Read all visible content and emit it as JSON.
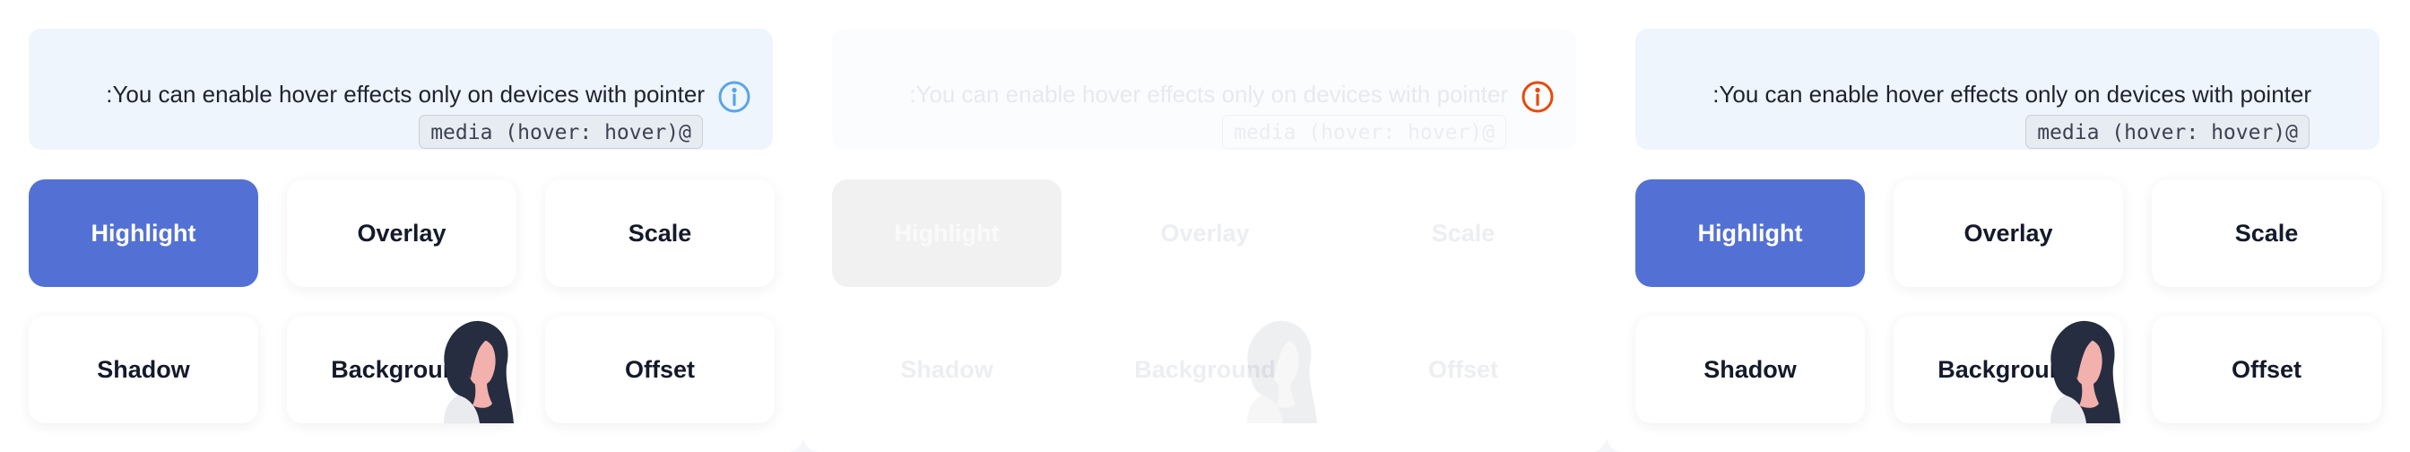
{
  "info": {
    "text": ":You can enable hover effects only on devices with pointer",
    "code": "media (hover: hover)@"
  },
  "buttons": [
    {
      "id": "highlight",
      "label": "Highlight"
    },
    {
      "id": "overlay",
      "label": "Overlay"
    },
    {
      "id": "scale",
      "label": "Scale"
    },
    {
      "id": "shadow",
      "label": "Shadow"
    },
    {
      "id": "background",
      "label": "Background"
    },
    {
      "id": "offset",
      "label": "Offset"
    }
  ],
  "icons": {
    "info": "info-circle-icon",
    "avatar": "woman-avatar-illustration"
  },
  "colors": {
    "accent": "#5371d4",
    "info_bg": "#eef5fd",
    "info_icon_blue": "#5aa5e6",
    "info_icon_orange": "#e64a0a",
    "text_dark": "#141a2b"
  }
}
